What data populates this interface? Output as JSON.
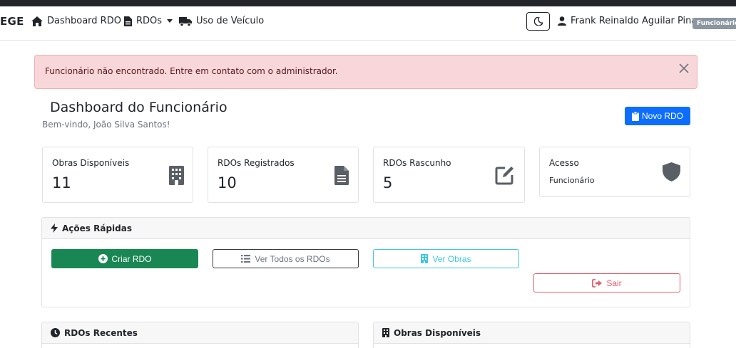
{
  "navbar": {
    "brand": "EGE",
    "items": [
      {
        "label": "Dashboard RDO",
        "icon": "home-icon"
      },
      {
        "label": "RDOs",
        "icon": "document-icon",
        "has_dropdown": true
      },
      {
        "label": "Uso de Veículo",
        "icon": "truck-icon"
      }
    ],
    "theme_toggle_icon": "moon-icon",
    "user_name": "Frank Reinaldo Aguilar Pina",
    "user_icon": "user-icon",
    "role_badge": "Funcionário"
  },
  "alert": {
    "message": "Funcionário não encontrado. Entre em contato com o administrador.",
    "close_icon": "close-icon"
  },
  "header": {
    "title": "Dashboard do Funcionário",
    "welcome": "Bem-vindo, João Silva Santos!",
    "new_button": "Novo RDO"
  },
  "stats": [
    {
      "label": "Obras Disponíveis",
      "value": "11",
      "icon": "building-icon"
    },
    {
      "label": "RDOs Registrados",
      "value": "10",
      "icon": "file-text-icon"
    },
    {
      "label": "RDOs Rascunho",
      "value": "5",
      "icon": "edit-icon"
    },
    {
      "label": "Acesso",
      "value": "Funcionário",
      "icon": "shield-icon"
    }
  ],
  "quick_actions": {
    "title": "Ações Rápidas",
    "buttons": {
      "create": "Criar RDO",
      "view_all": "Ver Todos os RDOs",
      "view_works": "Ver Obras",
      "logout": "Sair"
    }
  },
  "recent_rdos": {
    "title": "RDOs Recentes"
  },
  "available_works": {
    "title": "Obras Disponíveis"
  },
  "colors": {
    "primary": "#0d6efd",
    "success": "#198754",
    "info": "#3dc7dc",
    "danger": "#e35d6a",
    "alert_bg": "#f8d7da"
  }
}
